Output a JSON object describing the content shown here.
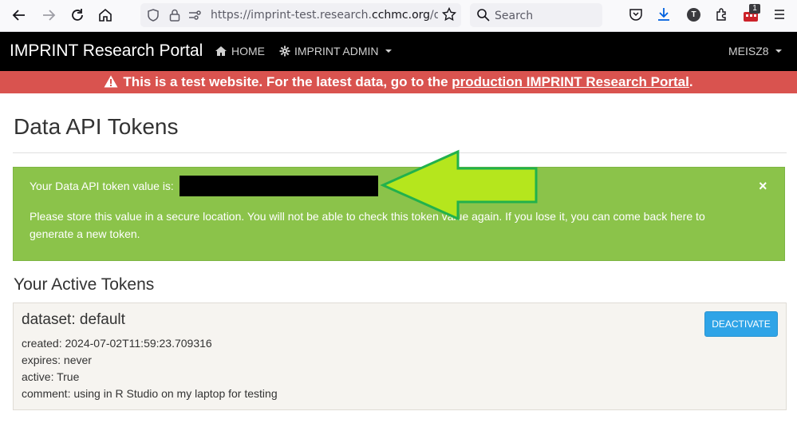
{
  "browser": {
    "url_prefix": "https://imprint-test.research.",
    "url_domain": "cchmc.org",
    "url_suffix": "/data_a",
    "search_placeholder": "Search",
    "profile_initial": "T",
    "extension_badge": "1"
  },
  "navbar": {
    "brand": "IMPRINT Research Portal",
    "home_label": "HOME",
    "admin_label": "IMPRINT ADMIN",
    "user_label": "MEISZ8"
  },
  "banner": {
    "text_before": "This is a test website. For the latest data, go to the ",
    "link_text": "production IMPRINT Research Portal",
    "text_after": "."
  },
  "page": {
    "title": "Data API Tokens",
    "alert": {
      "token_label": "Your Data API token value is:",
      "message": "Please store this value in a secure location. You will not be able to check this token value again. If you lose it, you can come back here to generate a new token.",
      "close": "×"
    },
    "section_title": "Your Active Tokens",
    "token": {
      "dataset": "dataset: default",
      "created": "created: 2024-07-02T11:59:23.709316",
      "expires": "expires: never",
      "active": "active: True",
      "comment": "comment: using in R Studio on my laptop for testing",
      "deactivate_label": "DEACTIVATE"
    }
  },
  "colors": {
    "navbar_bg": "#000000",
    "banner_bg": "#d9534f",
    "alert_bg": "#8bc34a",
    "button_bg": "#2fa4e7",
    "arrow_fill": "#b5e61d",
    "arrow_stroke": "#22b14c"
  }
}
